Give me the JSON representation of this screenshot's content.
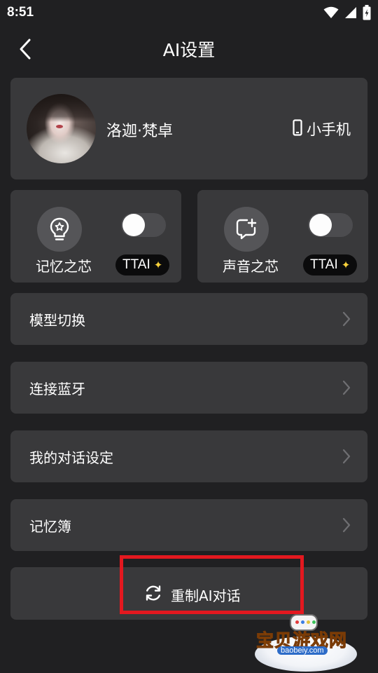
{
  "status_bar": {
    "time": "8:51",
    "icons": [
      "wifi-icon",
      "signal-icon",
      "battery-icon"
    ]
  },
  "header": {
    "back_icon": "chevron-left-icon",
    "title": "AI设置"
  },
  "profile": {
    "name": "洛迦·梵卓",
    "device_icon": "phone-icon",
    "device_label": "小手机"
  },
  "features": [
    {
      "label": "记忆之芯",
      "icon": "bulb-star-icon",
      "toggle_on": false,
      "badge": "TTAI",
      "badge_icon": "sparkle-icon"
    },
    {
      "label": "声音之芯",
      "icon": "chat-plus-icon",
      "toggle_on": false,
      "badge": "TTAI",
      "badge_icon": "sparkle-icon"
    }
  ],
  "menu": [
    {
      "label": "模型切换"
    },
    {
      "label": "连接蓝牙"
    },
    {
      "label": "我的对话设定"
    },
    {
      "label": "记忆簿"
    }
  ],
  "reset": {
    "icon": "refresh-icon",
    "label": "重制AI对话"
  },
  "watermark": {
    "text": "宝贝游戏网",
    "url": "baobeiy.com"
  },
  "colors": {
    "background": "#202022",
    "card": "#39393b",
    "highlight": "#e3181f",
    "badge_star": "#f8d13b"
  }
}
